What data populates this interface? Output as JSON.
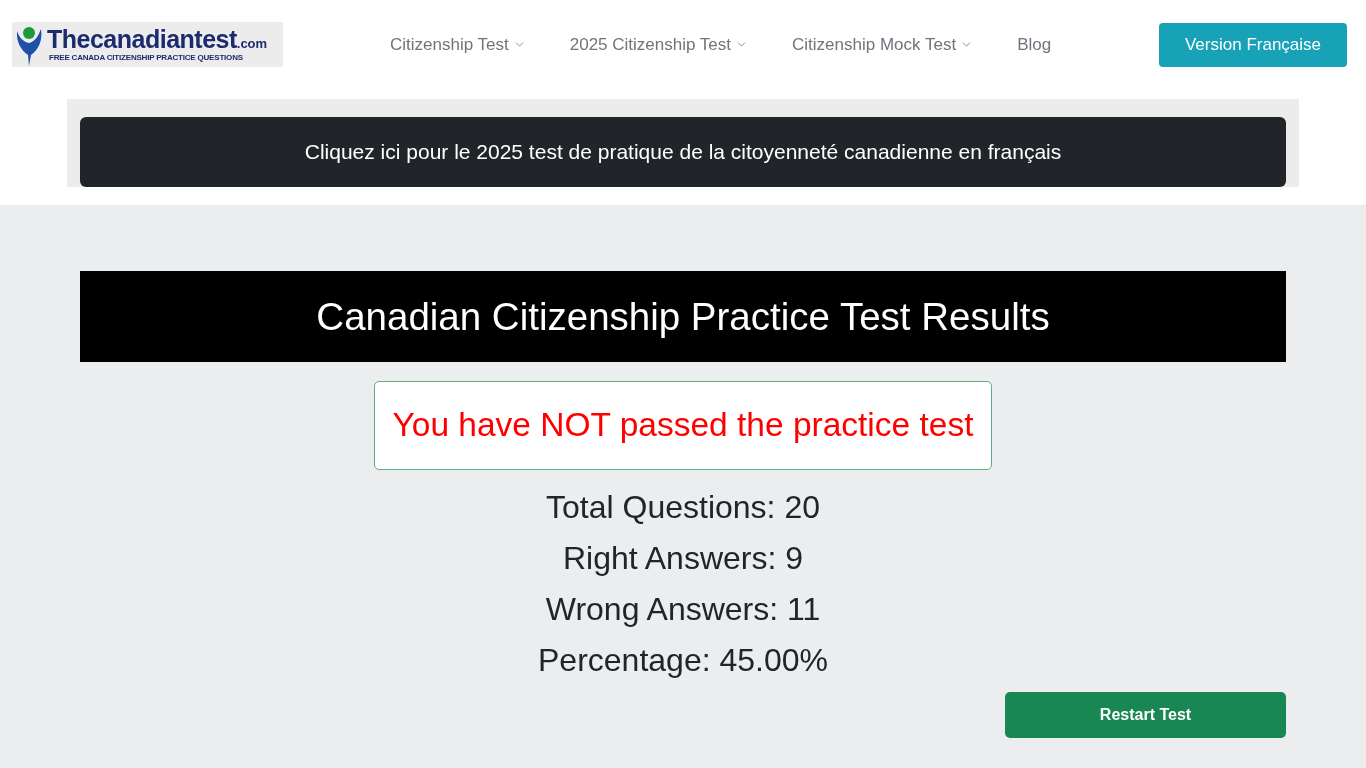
{
  "header": {
    "logo": {
      "name": "Thecanadiantest",
      "suffix": ".com",
      "tagline": "FREE CANADA CITIZENSHIP PRACTICE QUESTIONS"
    },
    "nav": [
      {
        "label": "Citizenship Test",
        "dropdown": true
      },
      {
        "label": "2025 Citizenship Test",
        "dropdown": true
      },
      {
        "label": "Citizenship Mock Test",
        "dropdown": true
      },
      {
        "label": "Blog",
        "dropdown": false
      }
    ],
    "language_button": "Version Française"
  },
  "banner": {
    "text": "Cliquez ici pour le 2025 test de pratique de la citoyenneté canadienne en français"
  },
  "results": {
    "title": "Canadian Citizenship Practice Test Results",
    "verdict": {
      "text": "You have NOT passed the practice test",
      "passed": false
    },
    "stats": [
      "Total Questions: 20",
      "Right Answers: 9",
      "Wrong Answers: 11",
      "Percentage: 45.00%"
    ],
    "restart_button": "Restart Test"
  }
}
